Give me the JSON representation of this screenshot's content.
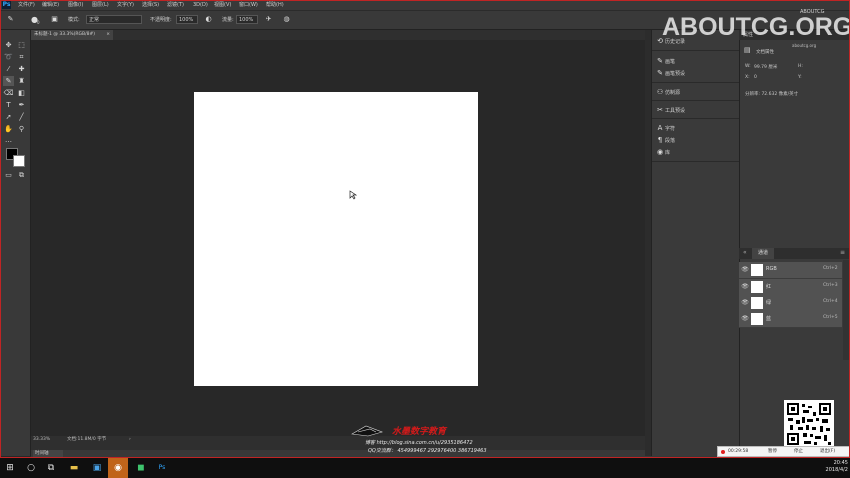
{
  "app": {
    "logo": "Ps"
  },
  "menubar": {
    "items": [
      "文件(F)",
      "编辑(E)",
      "图像(I)",
      "图层(L)",
      "文字(Y)",
      "选择(S)",
      "滤镜(T)",
      "3D(D)",
      "视图(V)",
      "窗口(W)",
      "帮助(H)"
    ]
  },
  "options": {
    "brush_size": "0",
    "mode_label": "模式:",
    "mode_value": "正常",
    "opacity_label": "不透明度:",
    "opacity_value": "100%",
    "flow_label": "流量:",
    "flow_value": "100%"
  },
  "document": {
    "tab_title": "未标题-1 @ 33.3%(RGB/8#)",
    "zoom": "33.33%",
    "doc_info": "文档:11.8M/0 字节"
  },
  "timeline": {
    "tab": "时间轴"
  },
  "dock1": {
    "items": [
      {
        "icon": "history-icon",
        "glyph": "⟲",
        "label": "历史记录"
      },
      {
        "icon": "brush-icon",
        "glyph": "✎",
        "label": "画笔"
      },
      {
        "icon": "brush-presets-icon",
        "glyph": "✎",
        "label": "画笔预设"
      },
      {
        "icon": "clone-source-icon",
        "glyph": "⚇",
        "label": "仿制源"
      },
      {
        "icon": "tool-presets-icon",
        "glyph": "✂",
        "label": "工具预设"
      },
      {
        "icon": "character-icon",
        "glyph": "A",
        "label": "字符"
      },
      {
        "icon": "paragraph-icon",
        "glyph": "¶",
        "label": "段落"
      },
      {
        "icon": "library-icon",
        "glyph": "◉",
        "label": "库"
      }
    ]
  },
  "properties": {
    "header": "属性",
    "doc_props": "文档属性",
    "w_label": "W:",
    "w_value": "99.79 厘米",
    "h_label": "H:",
    "x_label": "X:",
    "x_value": "0",
    "y_label": "Y:",
    "resolution": "分辨率: 72.632 像素/英寸"
  },
  "channels": {
    "tab": "通道",
    "rows": [
      {
        "name": "RGB",
        "shortcut": "Ctrl+2"
      },
      {
        "name": "红",
        "shortcut": "Ctrl+3"
      },
      {
        "name": "绿",
        "shortcut": "Ctrl+4"
      },
      {
        "name": "蓝",
        "shortcut": "Ctrl+5"
      }
    ]
  },
  "watermark": {
    "logo": "ABOUTCG.ORG",
    "sub": "ABOUTCG",
    "sub2": "aboutcg.org"
  },
  "credits": {
    "line1": "水墨数字教育",
    "line2": "博客 http://blog.sina.com.cn/u/2935186472",
    "line3": "QQ交流群：  454999467    292976400    386719463"
  },
  "recorder": {
    "time": "00:29:58",
    "pause": "暂停",
    "stop": "停止",
    "exit": "退出(F)"
  },
  "taskbar": {
    "time": "20:45",
    "date": "2018/4/2"
  },
  "colors": {
    "accent_red": "#c02424",
    "ps_blue": "#31a8ff"
  }
}
